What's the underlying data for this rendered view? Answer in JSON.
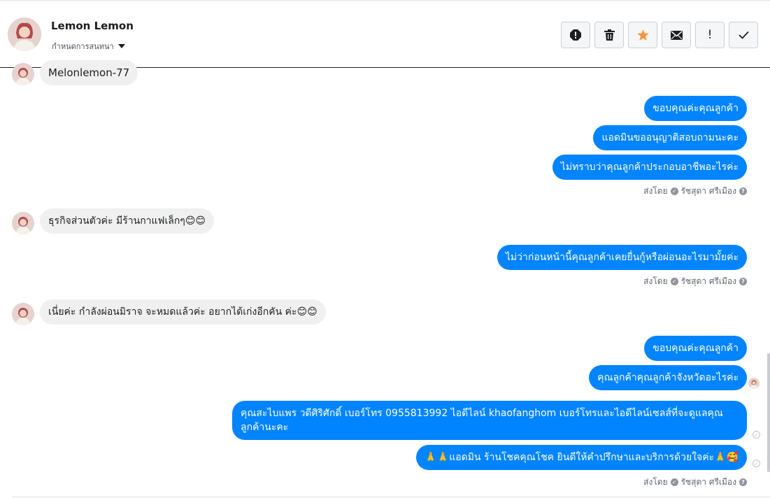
{
  "header": {
    "contact_name": "Lemon Lemon",
    "assign_label": "กำหนดการสนทนา",
    "actions": [
      {
        "name": "report-spam-icon"
      },
      {
        "name": "trash-icon"
      },
      {
        "name": "star-icon",
        "color": "#f7923b"
      },
      {
        "name": "mail-icon"
      },
      {
        "name": "priority-icon",
        "label": "!"
      },
      {
        "name": "done-check-icon",
        "label": "✓"
      }
    ]
  },
  "messages": {
    "m1": "Melonlemon-77",
    "m2": "ขอบคุณค่ะคุณลูกค้า",
    "m3": "แอดมินขออนุญาติสอบถามนะคะ",
    "m4": "ไม่ทราบว่าคุณลูกค้าประกอบอาชีพอะไรค่ะ",
    "m5": "ธุรกิจส่วนตัวค่ะ มีร้านกาแฟเล็กๆ😊😊",
    "m6": "ไม่ว่าก่อนหน้านี้คุณลูกค้าเคยยื่นกู้หรือผ่อนอะไรมามั้ยค่ะ",
    "m7": "เนี่ยค่ะ กำลังผ่อนมิราจ จะหมดแล้วค่ะ อยากได้เก่งอีกคัน ค่ะ😊😊",
    "m8": "ขอบคุณค่ะคุณลูกค้า",
    "m9": "คุณลูกค้าคุณลูกค้าจังหวัดอะไรค่ะ",
    "m10": "คุณสะไบแพร วดีศิริศักดิ์ เบอร์โทร 0955813992  ไอดีไลน์  khaofanghom   เบอร์โทรและไอดีไลน์เซลส์ที่จะดูแลคุณลูกค้านะคะ",
    "m11": "🙏🙏แอดมิน ร้านโชคคุณโชค ยินดีให้คำปรึกษาและบริการด้วยใจค่ะ🙏🥰"
  },
  "sent_by": {
    "label": "ส่งโดย",
    "agent": "รัชสุดา ศรีเมือง"
  },
  "colors": {
    "outgoing_bubble": "#0084ff",
    "incoming_bubble": "#f0f0f0"
  }
}
